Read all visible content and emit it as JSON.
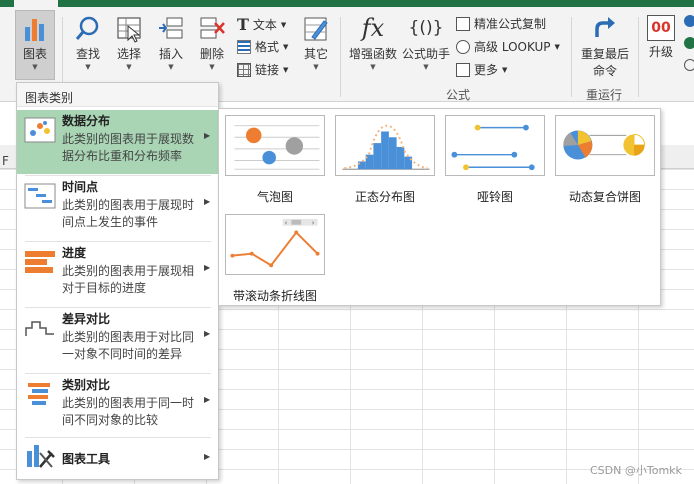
{
  "ribbon": {
    "buttons": {
      "chart": "图表",
      "find": "查找",
      "select": "选择",
      "insert": "插入",
      "delete": "删除",
      "other": "其它",
      "enhanced_func": "增强函数",
      "formula_helper": "公式助手",
      "repeat_last": "重复最后",
      "repeat_last_sub": "命令",
      "upgrade": "升级"
    },
    "small": {
      "text": "文本",
      "format": "格式",
      "link": "链接",
      "precise_copy": "精准公式复制",
      "advanced_lookup": "高级 LOOKUP",
      "more": "更多"
    },
    "icon_glyphs": {
      "fx": "fx",
      "braces": "{()}",
      "upgrade_digits": "00"
    },
    "groups": {
      "formula": "公式",
      "rerun": "重运行"
    }
  },
  "sheet": {
    "col_header_visible": "F"
  },
  "menu": {
    "header": "图表类别",
    "items": [
      {
        "title": "数据分布",
        "desc": "此类别的图表用于展现数据分布比重和分布频率",
        "active": true
      },
      {
        "title": "时间点",
        "desc": "此类别的图表用于展现时间点上发生的事件"
      },
      {
        "title": "进度",
        "desc": "此类别的图表用于展现相对于目标的进度"
      },
      {
        "title": "差异对比",
        "desc": "此类别的图表用于对比同一对象不同时间的差异"
      },
      {
        "title": "类别对比",
        "desc": "此类别的图表用于同一时间不同对象的比较"
      },
      {
        "title": "图表工具",
        "desc": ""
      }
    ]
  },
  "submenu": {
    "charts": [
      {
        "label": "气泡图"
      },
      {
        "label": "正态分布图"
      },
      {
        "label": "哑铃图"
      },
      {
        "label": "动态复合饼图"
      },
      {
        "label": "带滚动条折线图"
      }
    ]
  },
  "colors": {
    "excel_green": "#217346",
    "active_bg": "#a9d5b5",
    "orange": "#ed7d31",
    "blue": "#4a90d9"
  },
  "watermark": "CSDN @小Tomkk"
}
